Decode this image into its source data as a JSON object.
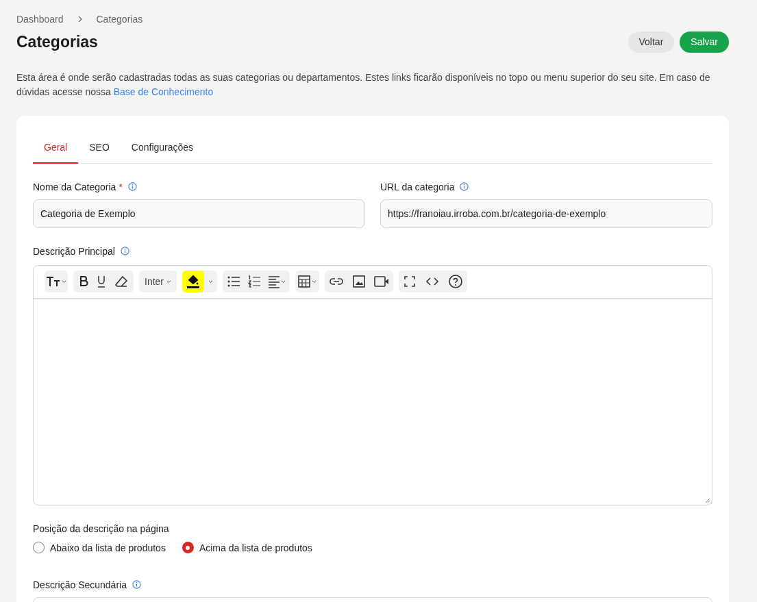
{
  "breadcrumb": [
    "Dashboard",
    "Categorias"
  ],
  "title": "Categorias",
  "buttons": [
    {
      "label": "Voltar",
      "kind": "secondary"
    },
    {
      "label": "Salvar",
      "kind": "primary"
    }
  ],
  "intro": {
    "text": "Esta área é onde serão cadastradas todas as suas categorias ou departamentos. Estes links ficarão disponíveis no topo ou menu superior do seu site. Em caso de dúvidas acesse nossa",
    "link": "Base de Conhecimento"
  },
  "tabs": [
    {
      "label": "Geral",
      "selected": true
    },
    {
      "label": "SEO",
      "selected": false
    },
    {
      "label": "Configurações",
      "selected": false
    }
  ],
  "fields": [
    {
      "label": "Nome da Categoria",
      "required_mark": "*",
      "value": "Categoria de Exemplo"
    },
    {
      "label": "URL da categoria",
      "value": "https://franoiau.irroba.com.br/categoria-de-exemplo"
    }
  ],
  "description": {
    "label": "Descrição Principal",
    "font": "Inter"
  },
  "position": {
    "label": "Posição da descrição na página",
    "options": [
      {
        "label": "Abaixo da lista de produtos",
        "selected": false
      },
      {
        "label": "Acima da lista de produtos",
        "selected": true
      }
    ]
  },
  "secondary": {
    "label": "Descrição Secundária"
  }
}
